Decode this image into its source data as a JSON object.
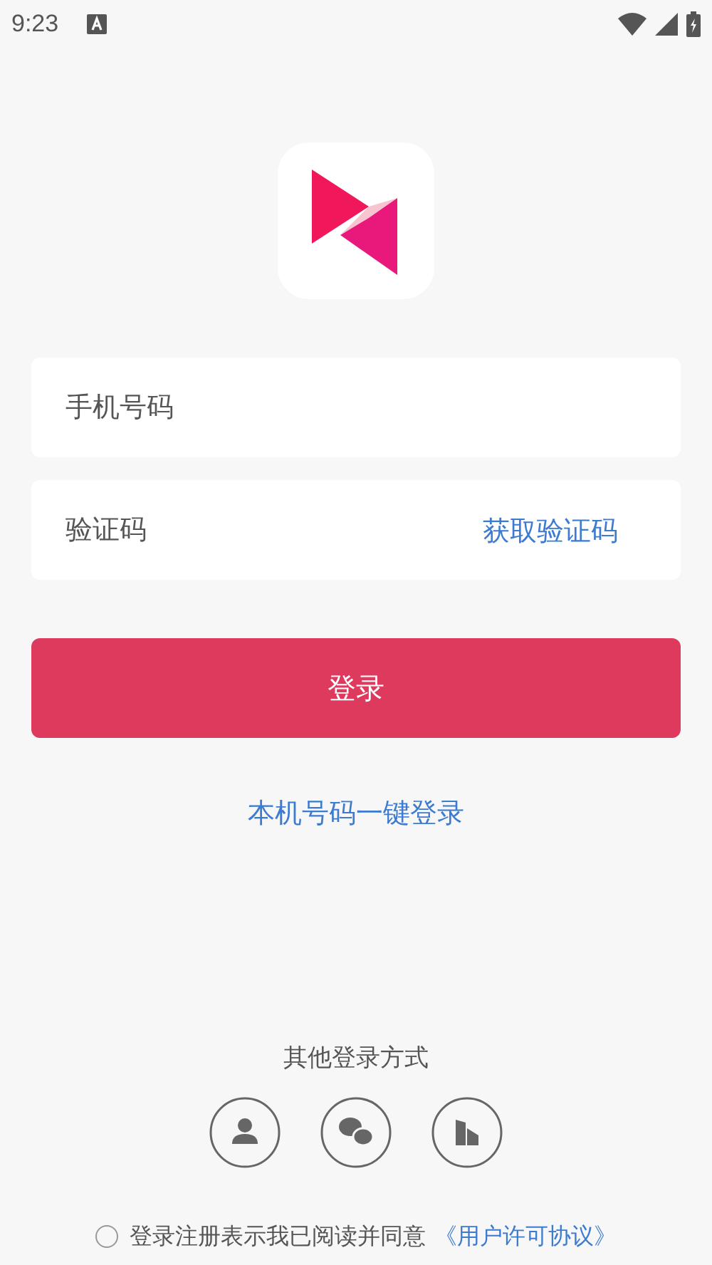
{
  "status_bar": {
    "time": "9:23"
  },
  "phone_field": {
    "placeholder": "手机号码"
  },
  "code_field": {
    "placeholder": "验证码",
    "action": "获取验证码"
  },
  "login_button": "登录",
  "one_tap_link": "本机号码一键登录",
  "other_methods": {
    "title": "其他登录方式",
    "items": [
      {
        "kind": "person"
      },
      {
        "kind": "chat"
      },
      {
        "kind": "building"
      }
    ]
  },
  "agreement": {
    "checked": false,
    "text": "登录注册表示我已阅读并同意",
    "link": "《用户许可协议》"
  }
}
